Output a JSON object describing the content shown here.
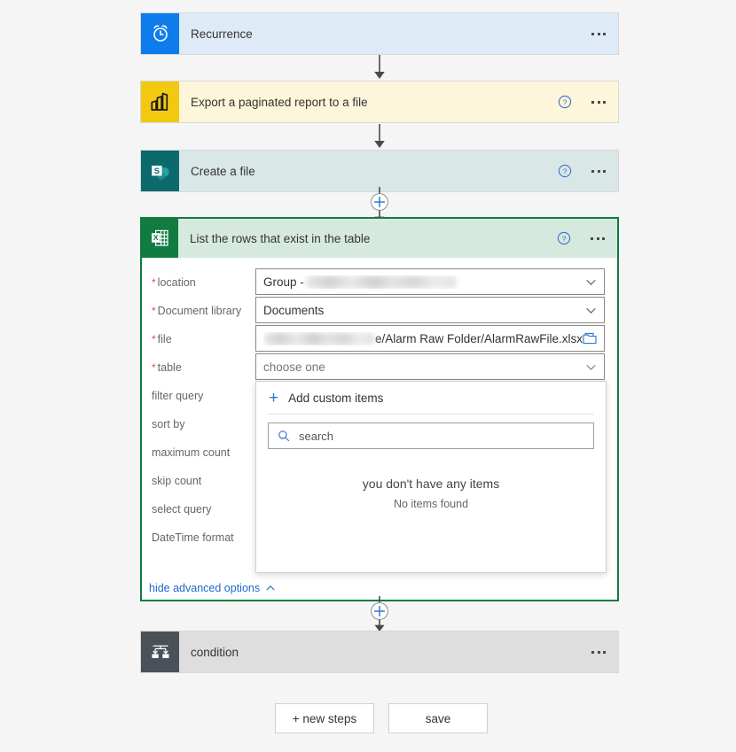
{
  "cards": [
    {
      "id": "recurrence",
      "title": "Recurrence",
      "icon": "alarm-clock-icon",
      "has_help": false
    },
    {
      "id": "export-paginated-report",
      "title": "Export a paginated report to a file",
      "icon": "power-bi-icon",
      "has_help": true
    },
    {
      "id": "create-a-file",
      "title": "Create a file",
      "icon": "sharepoint-icon",
      "has_help": true
    },
    {
      "id": "condition",
      "title": "condition",
      "icon": "condition-branch-icon",
      "has_help": false
    }
  ],
  "expanded_card": {
    "title": "List the rows that exist in the table",
    "icon": "excel-table-icon",
    "fields": [
      {
        "label": "location",
        "required": true,
        "value": "Group - ",
        "redacted": true,
        "control": "dropdown"
      },
      {
        "label": "Document library",
        "required": true,
        "value": "Documents",
        "redacted": false,
        "control": "dropdown"
      },
      {
        "label": "file",
        "required": true,
        "value": "e/Alarm Raw Folder/AlarmRawFile.xlsx",
        "redacted": true,
        "control": "file-picker"
      },
      {
        "label": "table",
        "required": true,
        "value": "choose one",
        "redacted": false,
        "control": "dropdown",
        "is_placeholder": true
      }
    ],
    "advanced_options": [
      "filter query",
      "sort by",
      "maximum count",
      "skip count",
      "select query",
      "DateTime format"
    ],
    "hide_advanced_label": "hide advanced options"
  },
  "dropdown": {
    "add_custom_items_label": "Add custom items",
    "search_placeholder": "search",
    "empty_title": "you don't have any items",
    "empty_subtitle": "No items found"
  },
  "actions": {
    "new_steps_label": "+ new steps",
    "save_label": "save"
  },
  "colors": {
    "page_background": "#f5f5f5",
    "recurrence_icon": "#0f7ceb",
    "recurrence_body": "#deebf7",
    "powerbi_icon": "#f2c811",
    "powerbi_body": "#fdf6da",
    "sharepoint_icon": "#0c6a6d",
    "sharepoint_body": "#d9e8e6",
    "excel_icon": "#107c41",
    "excel_header": "#d6e9de",
    "selected_border": "#107c41",
    "condition_icon": "#4a5159",
    "condition_body": "#dedede",
    "link_blue": "#2266cc",
    "accent_blue": "#2b7cd3",
    "required_red": "#e74c3c"
  }
}
